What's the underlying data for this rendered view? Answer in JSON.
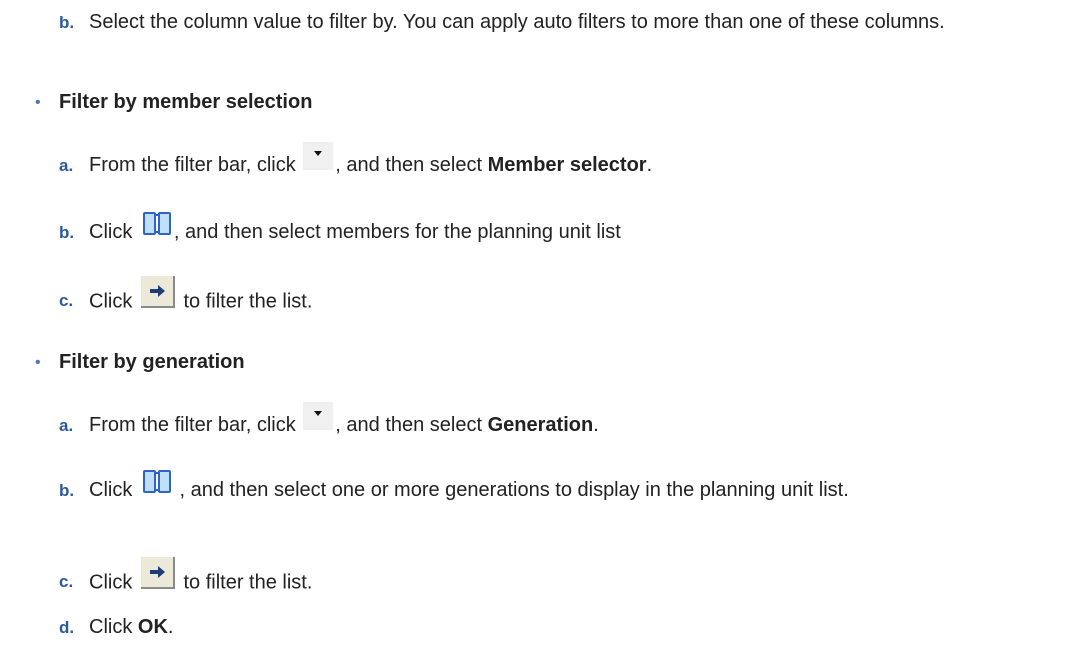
{
  "steps_top": [
    {
      "letter": "b.",
      "text": "Select the column value to filter by. You can apply auto filters to more than one of these columns."
    }
  ],
  "member": {
    "title": "Filter by member selection",
    "a": {
      "letter": "a.",
      "t1": "From the filter bar, click",
      "t2": ", and then select",
      "bold": "Member selector",
      "end": "."
    },
    "b": {
      "letter": "b.",
      "t1": "Click",
      "t2": ", and then select members for the planning unit list"
    },
    "c": {
      "letter": "c.",
      "t1": "Click",
      "t2": "to filter the list."
    }
  },
  "generation": {
    "title": "Filter by generation",
    "a": {
      "letter": "a.",
      "t1": "From the filter bar, click",
      "t2": ", and then select",
      "bold": "Generation",
      "end": "."
    },
    "b": {
      "letter": "b.",
      "t1": "Click",
      "t2": ", and then select one or more generations to display in the planning unit list."
    },
    "c": {
      "letter": "c.",
      "t1": "Click",
      "t2": "to filter the list."
    },
    "d": {
      "letter": "d.",
      "t1": "Click",
      "bold": "OK",
      "end": "."
    }
  },
  "icons": {
    "dropdown": "dropdown-arrow-icon",
    "member_selector": "member-selector-icon",
    "go": "go-arrow-icon"
  }
}
